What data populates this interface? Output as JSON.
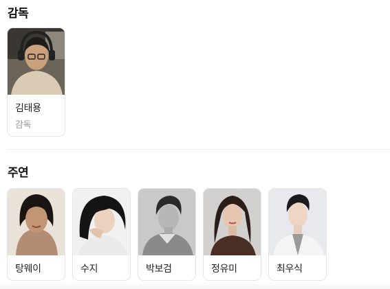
{
  "director_section": {
    "title": "감독",
    "people": [
      {
        "name": "김태용",
        "role": "감독",
        "photo_icon": "director-portrait"
      }
    ]
  },
  "cast_section": {
    "title": "주연",
    "people": [
      {
        "name": "탕웨이",
        "photo_icon": "actor-portrait"
      },
      {
        "name": "수지",
        "photo_icon": "actor-portrait"
      },
      {
        "name": "박보검",
        "photo_icon": "actor-portrait"
      },
      {
        "name": "정유미",
        "photo_icon": "actor-portrait"
      },
      {
        "name": "최우식",
        "photo_icon": "actor-portrait"
      }
    ]
  }
}
